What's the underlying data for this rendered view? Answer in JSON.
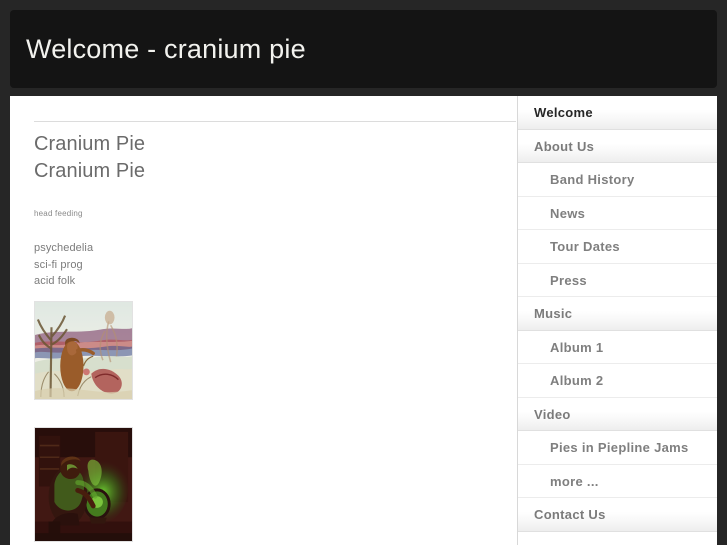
{
  "header": {
    "title": "Welcome - cranium pie"
  },
  "content": {
    "heading_1": "Cranium Pie",
    "heading_2": "Cranium Pie",
    "tagline": "head feeding",
    "genres": [
      "psychedelia",
      "sci-fi prog",
      "acid folk"
    ],
    "images": [
      {
        "name": "album-cover-1",
        "alt": "Painting of a robed figure in a pastel landscape"
      },
      {
        "name": "album-cover-2",
        "alt": "Dark red and green duotone of a seated figure with a glowing vessel"
      }
    ]
  },
  "sidebar": {
    "items": [
      {
        "label": "Welcome",
        "level": 1,
        "current": true
      },
      {
        "label": "About Us",
        "level": 1,
        "current": false
      },
      {
        "label": "Band History",
        "level": 2,
        "current": false
      },
      {
        "label": "News",
        "level": 2,
        "current": false
      },
      {
        "label": "Tour Dates",
        "level": 2,
        "current": false
      },
      {
        "label": "Press",
        "level": 2,
        "current": false
      },
      {
        "label": "Music",
        "level": 1,
        "current": false
      },
      {
        "label": "Album 1",
        "level": 2,
        "current": false
      },
      {
        "label": "Album 2",
        "level": 2,
        "current": false
      },
      {
        "label": "Video",
        "level": 1,
        "current": false
      },
      {
        "label": "Pies in Piepline Jams",
        "level": 2,
        "current": false
      },
      {
        "label": "more ...",
        "level": 2,
        "current": false
      },
      {
        "label": "Contact Us",
        "level": 1,
        "current": false
      }
    ]
  },
  "colors": {
    "page_background": "#262626",
    "header_background": "#141414",
    "header_text": "#f2f2ee",
    "panel_background": "#ffffff",
    "heading_text": "#6b6b6b",
    "body_text": "#7c7c7c",
    "nav_level1_text": "#7b7b7b",
    "nav_current_text": "#262626",
    "nav_level2_text": "#7f7f7f",
    "divider": "#e8e8e8"
  }
}
